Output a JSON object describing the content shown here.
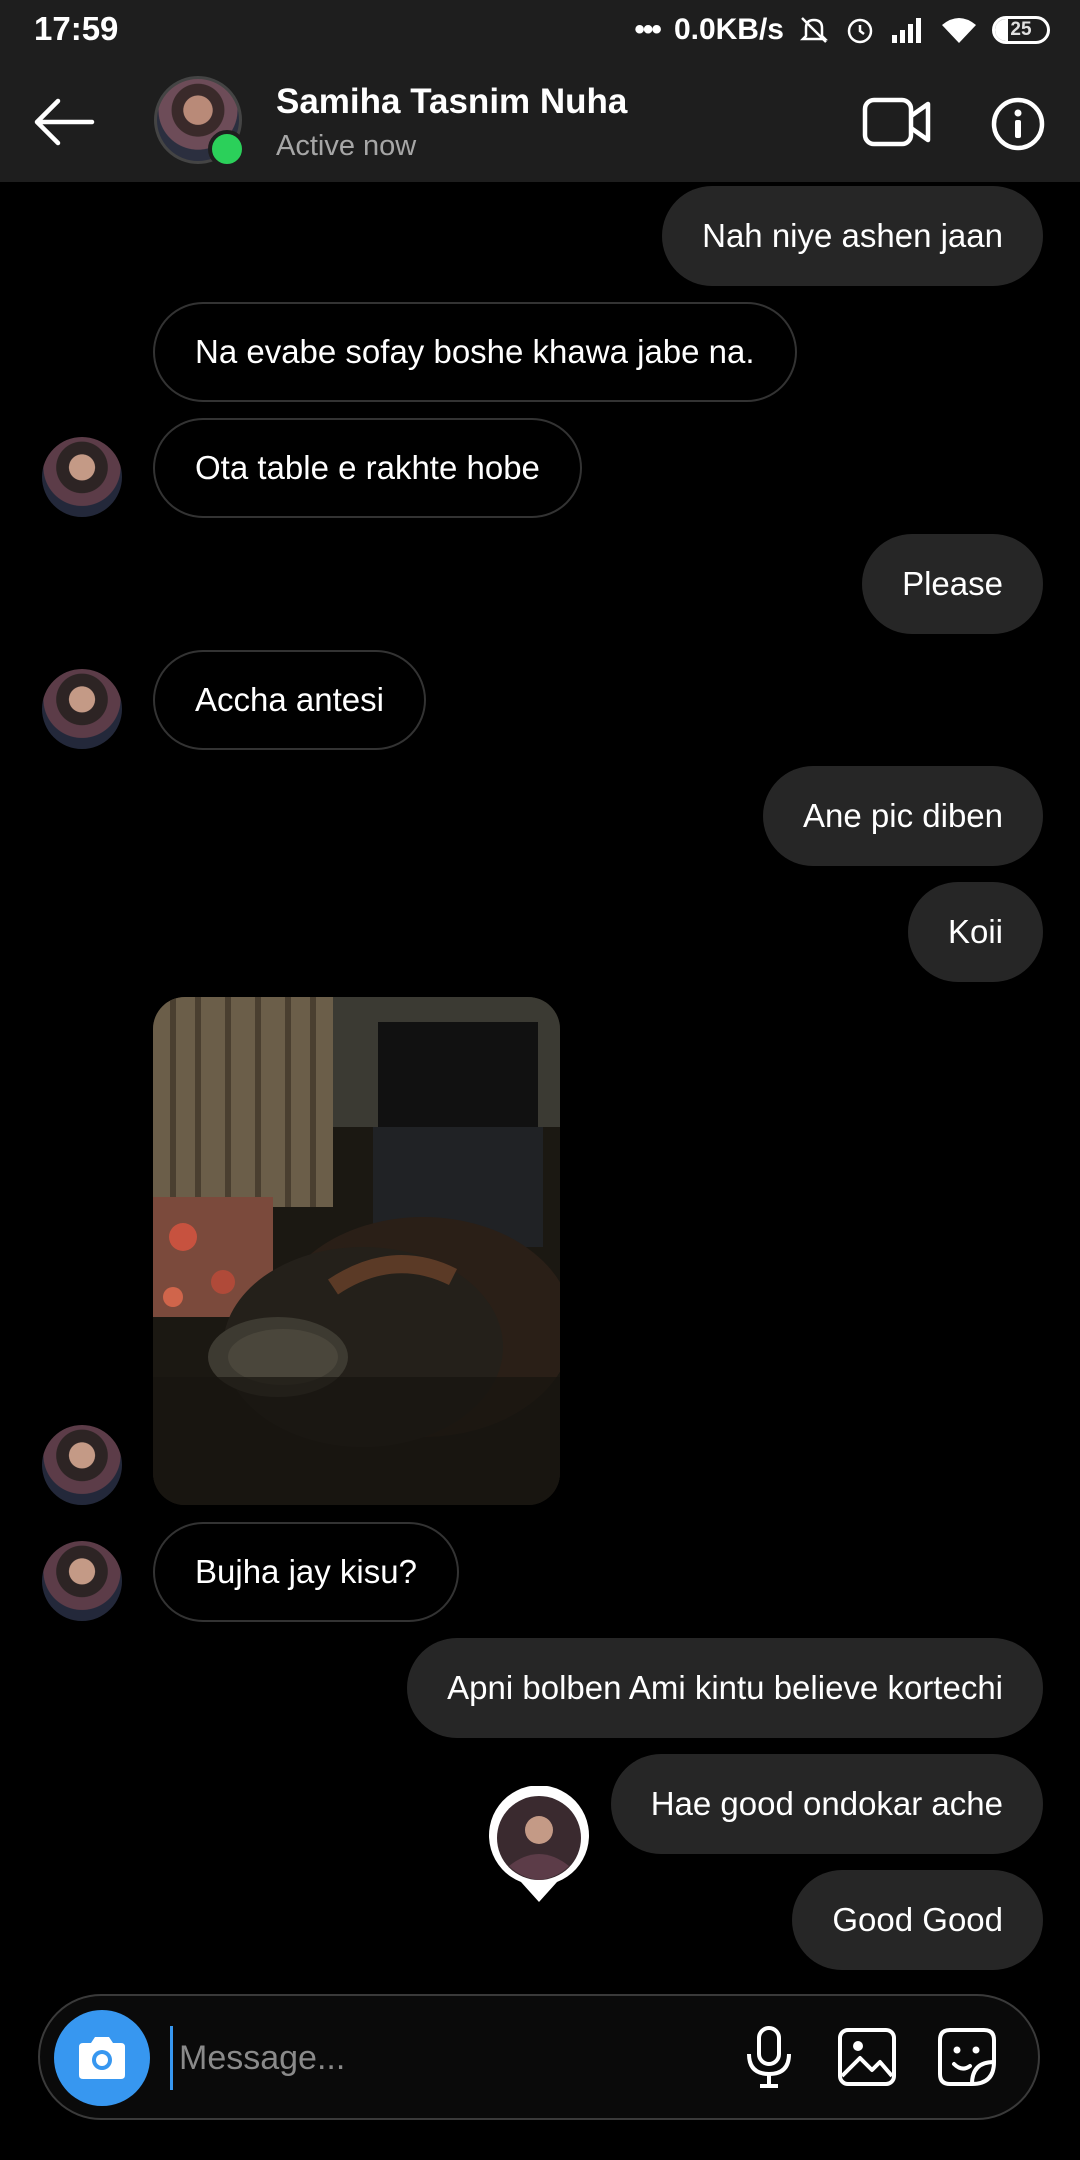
{
  "status_bar": {
    "time": "17:59",
    "network_speed": "0.0KB/s",
    "battery_level": "25",
    "icons": [
      "dots-icon",
      "mute-icon",
      "alarm-icon",
      "signal-icon",
      "wifi-icon",
      "battery-icon"
    ]
  },
  "header": {
    "contact_name": "Samiha Tasnim Nuha",
    "contact_status": "Active now",
    "icons": [
      "back-arrow-icon",
      "video-call-icon",
      "info-icon"
    ]
  },
  "messages": [
    {
      "dir": "out",
      "text": "Nah niye ashen jaan"
    },
    {
      "dir": "in",
      "text": "Na evabe sofay boshe khawa jabe na."
    },
    {
      "dir": "in",
      "text": "Ota table e rakhte hobe"
    },
    {
      "dir": "out",
      "text": "Please"
    },
    {
      "dir": "in",
      "text": "Accha antesi"
    },
    {
      "dir": "out",
      "text": "Ane pic diben"
    },
    {
      "dir": "out",
      "text": "Koii"
    },
    {
      "dir": "in",
      "text": "Bujha jay kisu?"
    },
    {
      "dir": "out",
      "text": "Apni bolben Ami kintu believe kortechi"
    },
    {
      "dir": "out",
      "text": "Hae good ondokar ache"
    },
    {
      "dir": "out",
      "text": "Good Good"
    }
  ],
  "composer": {
    "placeholder": "Message...",
    "icons": [
      "camera-icon",
      "microphone-icon",
      "gallery-icon",
      "sticker-icon"
    ]
  },
  "colors": {
    "accent": "#3797f0",
    "online": "#2bd05a",
    "outgoing_bubble": "#262626",
    "header_bg": "#1e1e1e"
  }
}
